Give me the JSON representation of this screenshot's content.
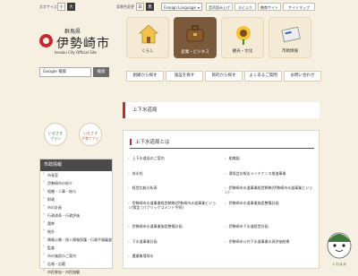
{
  "header": {
    "text_size_label": "文字サイズ",
    "size_small": "小",
    "size_large": "大",
    "bg_color_label": "背景色変更",
    "bg_white": "白",
    "bg_black": "黒",
    "language_select": "Foreign Language",
    "links": [
      "音声読み上げ",
      "ルビふり",
      "携帯サイト",
      "サイトマップ"
    ]
  },
  "logo": {
    "prefecture": "群馬県",
    "city": "伊勢崎市",
    "english": "Isesaki City Official Site"
  },
  "search": {
    "placeholder": "Google 検索",
    "button": "検索"
  },
  "circle_buttons": [
    {
      "line1": "いせさき",
      "line2": "プラン"
    },
    {
      "line1": "いせさき",
      "line2": "子育てナビ"
    }
  ],
  "tiles": [
    {
      "label": "くらし",
      "icon": "house-icon"
    },
    {
      "label": "産業・ビジネス",
      "icon": "briefcase-icon"
    },
    {
      "label": "観光・文化",
      "icon": "sunflower-icon"
    },
    {
      "label": "市政情報",
      "icon": "newspaper-icon"
    }
  ],
  "nav_buttons": [
    "組織から探す",
    "施設を探す",
    "目的から探す",
    "よくあるご質問",
    "お問い合わせ"
  ],
  "sidebar": {
    "heading": "市政情報",
    "items": [
      "市長室",
      "伊勢崎市の紹介",
      "組織・人事・給与",
      "財政",
      "市の計画",
      "行政改革・行政評価",
      "選挙",
      "統計",
      "情報公開・個人情報保護・行政不服審査",
      "監査",
      "市の施設のご案内",
      "広報・広聴",
      "市民参加・市民協働"
    ]
  },
  "main": {
    "page_title": "上下水道局",
    "section_title": "上下水道局とは",
    "links": [
      "上下水道局のご案内",
      "組織図",
      "排水栓",
      "環境会計報告メンテナンス推進事業",
      "経営比較分析表",
      "伊勢崎市水道事業経営戦略(伊勢崎市水道事業ビジョン)",
      "伊勢崎市水道事業経営戦略(伊勢崎市水道事業ビジョン)策定 (パブリックコメント手続)",
      "伊勢崎市水道事業施設整備計画",
      "伊勢崎市水道事業施設整備計画",
      "伊勢崎市下水道経営計画",
      "下水道事業計画",
      "伊勢崎市公共下水道事業の再評価結果",
      "農業集落排水",
      ""
    ]
  },
  "mascot": {
    "name": "くわまる"
  },
  "colors": {
    "accent": "#c7282f",
    "background": "#f6f0e3",
    "dark": "#4a4a4a"
  }
}
